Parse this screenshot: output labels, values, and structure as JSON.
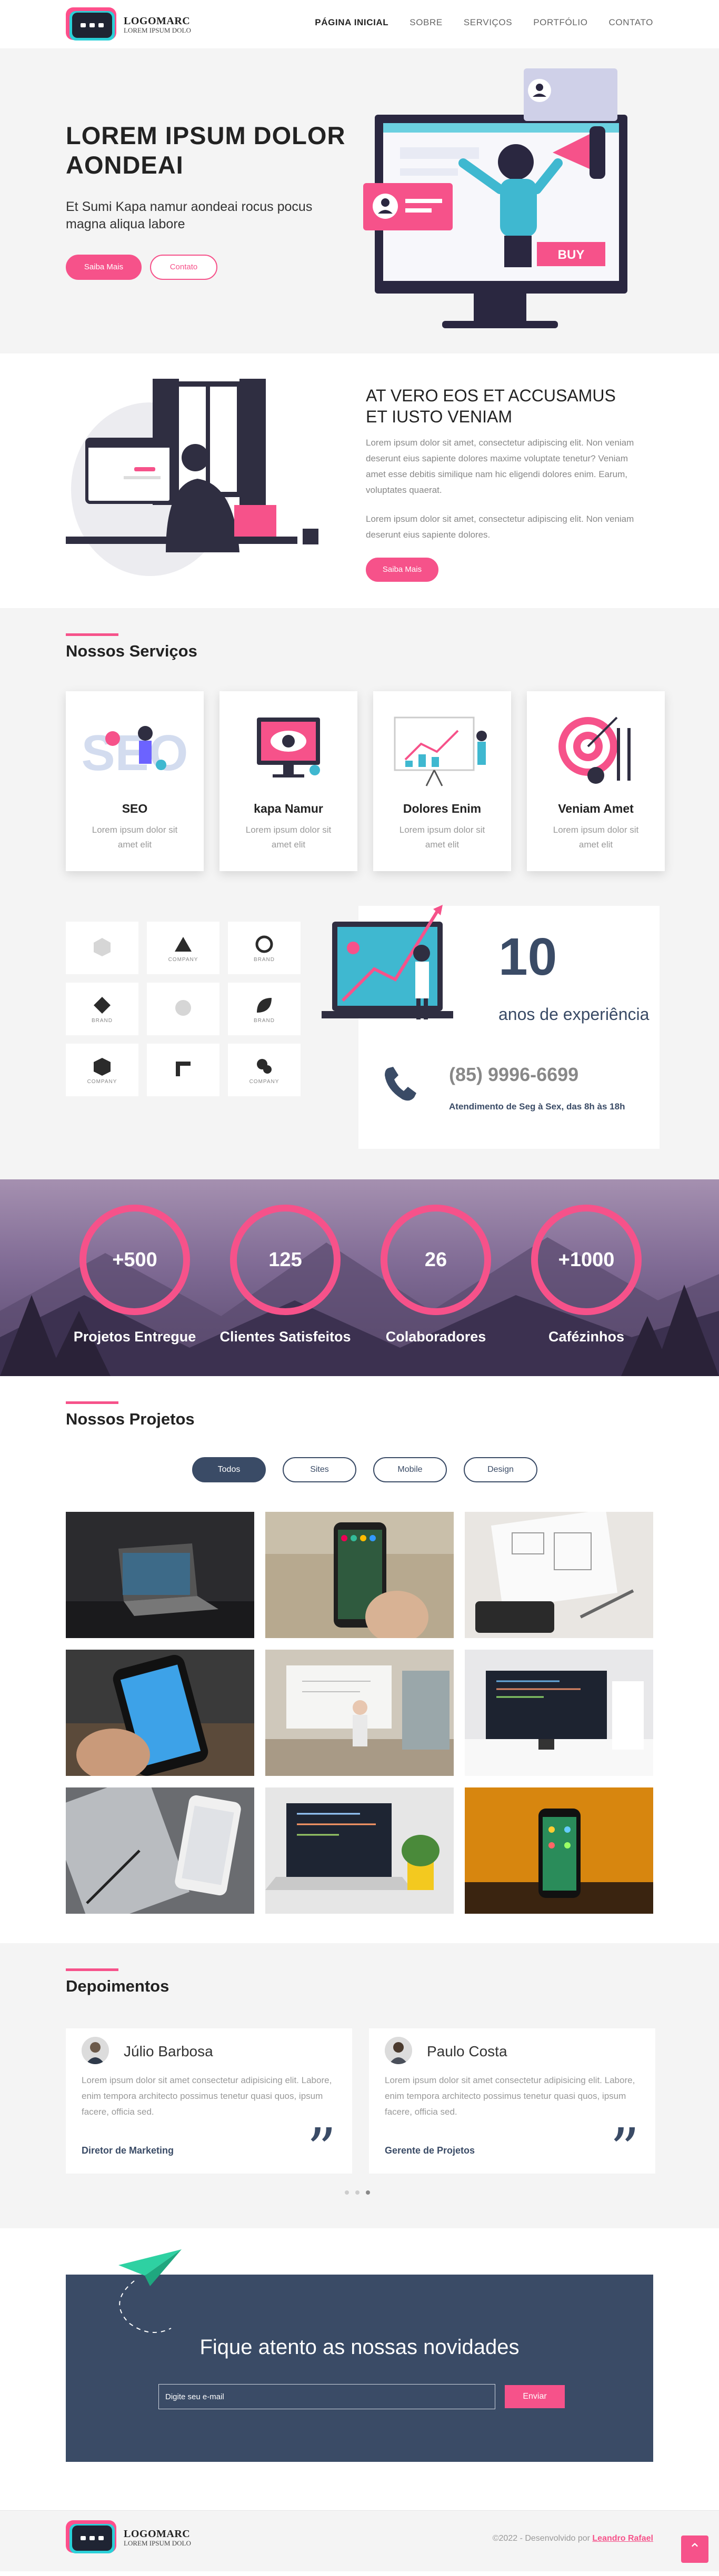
{
  "header": {
    "logo_title": "LOGOMARC",
    "logo_subtitle": "LOREM IPSUM DOLO",
    "nav": [
      "PÁGINA INICIAL",
      "SOBRE",
      "SERVIÇOS",
      "PORTFÓLIO",
      "CONTATO"
    ],
    "active_nav": "PÁGINA INICIAL"
  },
  "hero": {
    "title": "LOREM IPSUM DOLOR AONDEAI",
    "subtitle": "Et Sumi Kapa namur aondeai rocus pocus magna aliqua labore",
    "primary_button": "Saiba Mais",
    "secondary_button": "Contato",
    "buy_label": "BUY"
  },
  "about": {
    "title": "AT VERO EOS ET ACCUSAMUS ET IUSTO VENIAM",
    "paragraph1": "Lorem ipsum dolor sit amet, consectetur adipiscing elit. Non veniam deserunt eius sapiente dolores maxime voluptate tenetur? Veniam amet esse debitis similique nam hic eligendi dolores enim. Earum, voluptates quaerat.",
    "paragraph2": "Lorem ipsum dolor sit amet, consectetur adipiscing elit. Non veniam deserunt eius sapiente dolores.",
    "button": "Saiba Mais"
  },
  "services": {
    "title": "Nossos Serviços",
    "items": [
      {
        "title": "SEO",
        "desc": "Lorem ipsum dolor sit amet elit"
      },
      {
        "title": "kapa Namur",
        "desc": "Lorem ipsum dolor sit amet elit"
      },
      {
        "title": "Dolores Enim",
        "desc": "Lorem ipsum dolor sit amet elit"
      },
      {
        "title": "Veniam Amet",
        "desc": "Lorem ipsum dolor sit amet elit"
      }
    ]
  },
  "clients": {
    "logos": [
      "",
      "COMPANY",
      "BRAND",
      "BRAND",
      "",
      "BRAND",
      "COMPANY",
      "",
      "COMPANY"
    ]
  },
  "experience": {
    "years": "10",
    "years_label": "anos de experiência",
    "phone": "(85) 9996-6699",
    "hours": "Atendimento de Seg à Sex, das 8h às 18h"
  },
  "stats": [
    {
      "value": "+500",
      "label": "Projetos Entregue"
    },
    {
      "value": "125",
      "label": "Clientes Satisfeitos"
    },
    {
      "value": "26",
      "label": "Colaboradores"
    },
    {
      "value": "+1000",
      "label": "Cafézinhos"
    }
  ],
  "projects": {
    "title": "Nossos Projetos",
    "filters": [
      "Todos",
      "Sites",
      "Mobile",
      "Design"
    ],
    "active_filter": "Todos"
  },
  "testimonials": {
    "title": "Depoimentos",
    "items": [
      {
        "name": "Júlio Barbosa",
        "text": "Lorem ipsum dolor sit amet consectetur adipisicing elit. Labore, enim tempora architecto possimus tenetur quasi quos, ipsum facere, officia sed.",
        "role": "Diretor de Marketing"
      },
      {
        "name": "Paulo Costa",
        "text": "Lorem ipsum dolor sit amet consectetur adipisicing elit. Labore, enim tempora architecto possimus tenetur quasi quos, ipsum facere, officia sed.",
        "role": "Gerente de Projetos"
      }
    ]
  },
  "newsletter": {
    "title": "Fique atento as nossas novidades",
    "placeholder": "Digite seu e-mail",
    "button": "Enviar"
  },
  "footer": {
    "logo_title": "LOGOMARC",
    "logo_subtitle": "LOREM IPSUM DOLO",
    "copyright": "©2022 - Desenvolvido por ",
    "author": "Leandro Rafael"
  },
  "colors": {
    "accent": "#f6528a",
    "navy": "#3a4b66",
    "light_bg": "#f4f4f4"
  }
}
